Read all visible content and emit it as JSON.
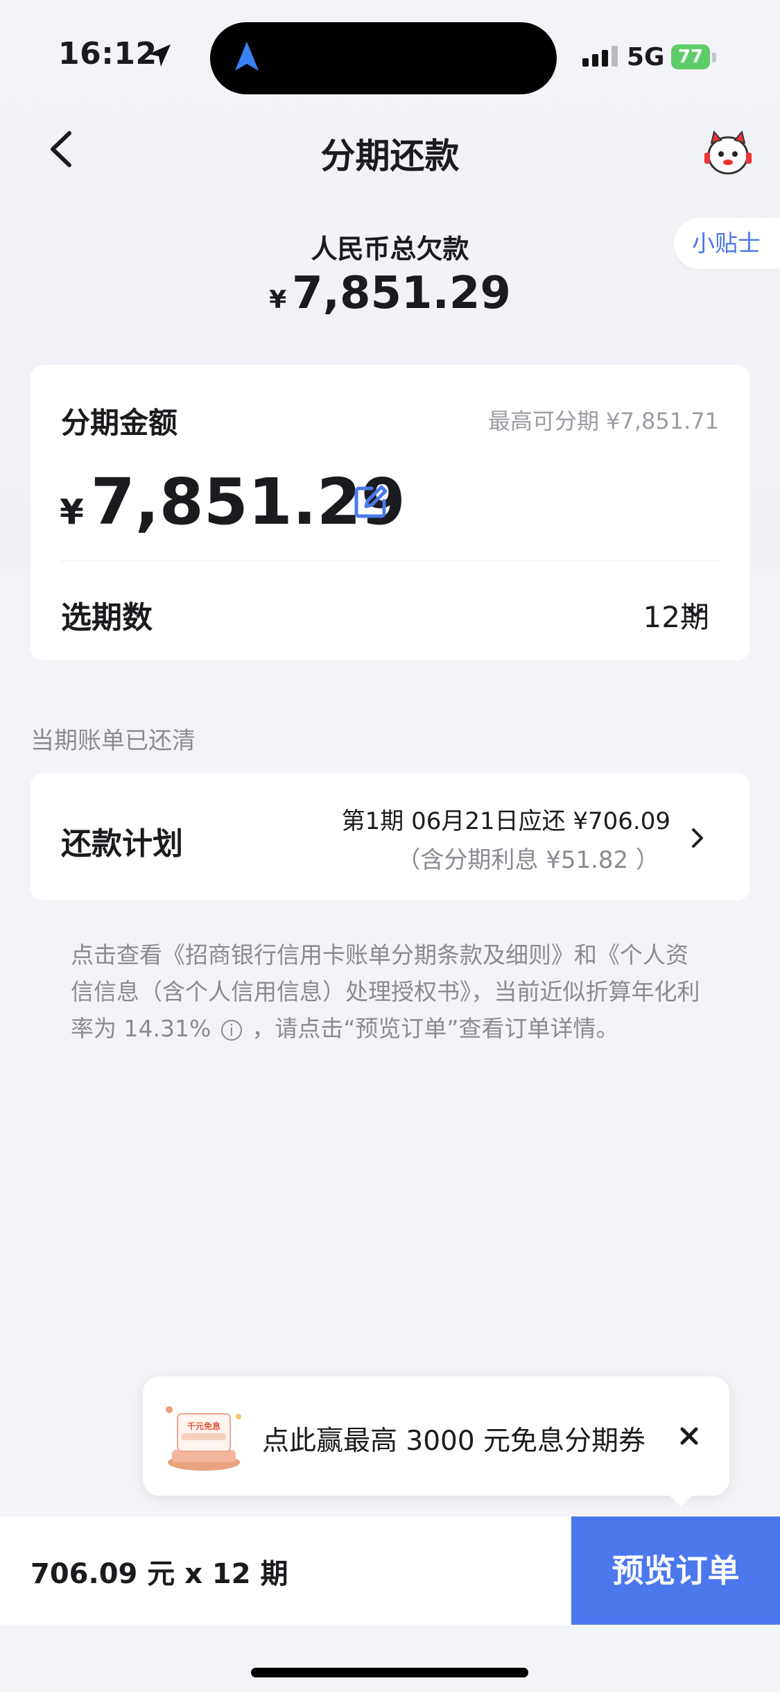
{
  "status_bar": {
    "time": "16:12",
    "network": "5G",
    "battery": "77"
  },
  "header": {
    "title": "分期还款",
    "back_icon": "chevron-left-icon",
    "service_icon": "customer-service-mascot-icon"
  },
  "tips_label": "小贴士",
  "summary": {
    "label": "人民币总欠款",
    "currency": "¥",
    "amount": "7,851.29"
  },
  "installment_card": {
    "label": "分期金额",
    "max_text": "最高可分期 ¥7,851.71",
    "currency": "¥",
    "amount": "7,851.29",
    "period_label": "选期数",
    "period_value": "12期"
  },
  "cleared_text": "当期账单已还清",
  "plan_card": {
    "label": "还款计划",
    "line1": "第1期 06月21日应还 ¥706.09",
    "line2": "（含分期利息 ¥51.82 ）"
  },
  "terms": {
    "part1": "点击查看《招商银行信用卡账单分期条款及细则》和《个人资信信息（含个人信用信息）处理授权书》，当前近似折算年化利率为 14.31%",
    "info_glyph": "i",
    "part2": "，请点击“预览订单”查看订单详情。"
  },
  "promo": {
    "text": "点此赢最高 3000 元免息分期券",
    "img_label": "千元免息"
  },
  "bottom": {
    "summary": "706.09 元 x 12 期",
    "button": "预览订单"
  },
  "colors": {
    "accent": "#4c78ee",
    "tips_text": "#4b74e8",
    "background": "#f3f4f8"
  }
}
